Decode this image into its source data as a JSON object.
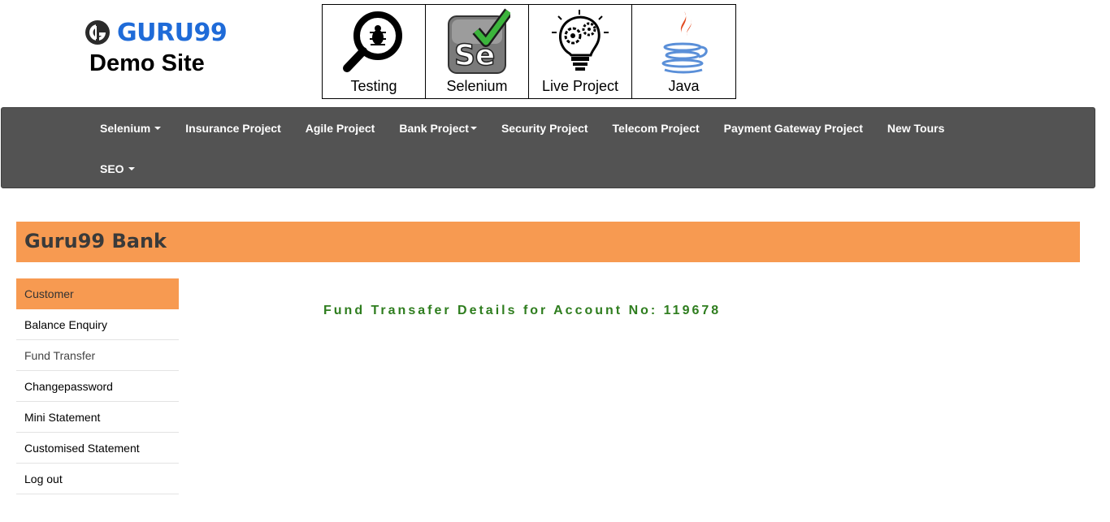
{
  "header": {
    "logo_text": "GURU99",
    "subtitle": "Demo Site",
    "logo_color": "#1f6bd8"
  },
  "tiles": [
    {
      "label": "Testing",
      "icon": "magnifier-bug-icon"
    },
    {
      "label": "Selenium",
      "icon": "selenium-check-icon"
    },
    {
      "label": "Live Project",
      "icon": "lightbulb-gears-icon"
    },
    {
      "label": "Java",
      "icon": "java-cup-icon"
    }
  ],
  "navbar": {
    "background": "#535353",
    "items": [
      {
        "label": "Selenium",
        "dropdown": true
      },
      {
        "label": "Insurance Project",
        "dropdown": false
      },
      {
        "label": "Agile Project",
        "dropdown": false
      },
      {
        "label": "Bank Project",
        "dropdown": true
      },
      {
        "label": "Security Project",
        "dropdown": false
      },
      {
        "label": "Telecom Project",
        "dropdown": false
      },
      {
        "label": "Payment Gateway Project",
        "dropdown": false
      },
      {
        "label": "New Tours",
        "dropdown": false
      }
    ],
    "row2": [
      {
        "label": "SEO",
        "dropdown": true
      }
    ]
  },
  "bank": {
    "title": "Guru99 Bank",
    "accent": "#f79a51"
  },
  "side_menu": [
    {
      "label": "Customer",
      "active": true
    },
    {
      "label": "Balance Enquiry",
      "active": false
    },
    {
      "label": "Fund Transfer",
      "active": false
    },
    {
      "label": "Changepassword",
      "active": false
    },
    {
      "label": "Mini Statement",
      "active": false
    },
    {
      "label": "Customised Statement",
      "active": false
    },
    {
      "label": "Log out",
      "active": false
    }
  ],
  "main": {
    "heading": "Fund Transafer Details for Account No: 119678",
    "heading_color": "#2e7d1e"
  }
}
